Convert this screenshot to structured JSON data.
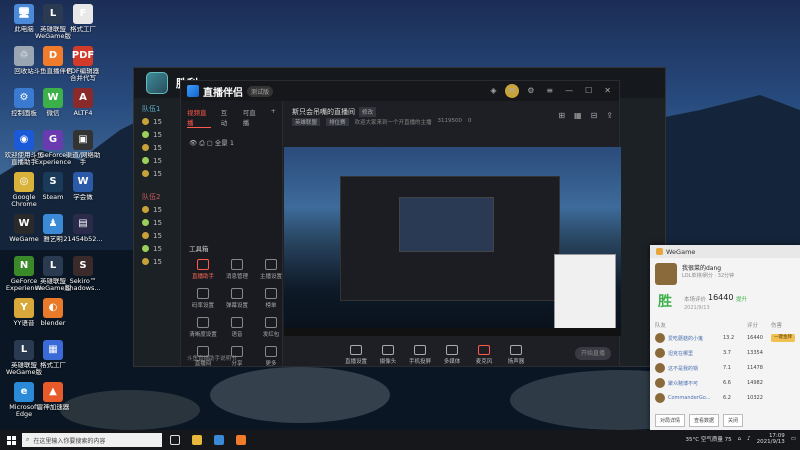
{
  "desktop": {
    "icons": [
      {
        "label": "此电脑",
        "color": "#4a8ad8",
        "glyph": "🖥"
      },
      {
        "label": "英雄联盟WeGame版",
        "color": "#2a3a50",
        "glyph": "L"
      },
      {
        "label": "格式工厂",
        "color": "#e8e8e8",
        "glyph": "F"
      },
      {
        "label": "回收站",
        "color": "#9aa6b2",
        "glyph": "♲"
      },
      {
        "label": "斗鱼直播伴侣",
        "color": "#f07b2a",
        "glyph": "D"
      },
      {
        "label": "PDF编辑器 合并代写",
        "color": "#d23a2a",
        "glyph": "PDF"
      },
      {
        "label": "控制面板",
        "color": "#3a7ad0",
        "glyph": "⚙"
      },
      {
        "label": "微信",
        "color": "#3cb14a",
        "glyph": "W"
      },
      {
        "label": "ALTF4",
        "color": "#8a2a2a",
        "glyph": "A"
      },
      {
        "label": "欢迎使用斗鱼直播助手",
        "color": "#1a5ad8",
        "glyph": "◉"
      },
      {
        "label": "GeForce Experience",
        "color": "#6a3ab0",
        "glyph": "G"
      },
      {
        "label": "渠道/网络助手",
        "color": "#333",
        "glyph": "▣"
      },
      {
        "label": "Google Chrome",
        "color": "#d8b23a",
        "glyph": "◎"
      },
      {
        "label": "Steam",
        "color": "#1a3a5a",
        "glyph": "S"
      },
      {
        "label": "学会做",
        "color": "#2a5aa8",
        "glyph": "W"
      },
      {
        "label": "WeGame",
        "color": "#2a2a2a",
        "glyph": "W"
      },
      {
        "label": "雅艺明",
        "color": "#3a8ad8",
        "glyph": "♟"
      },
      {
        "label": "21454b52...",
        "color": "#2a2a4a",
        "glyph": "▤"
      },
      {
        "label": "GeForce Experience",
        "color": "#3a8a2a",
        "glyph": "N"
      },
      {
        "label": "英雄联盟WeGame版",
        "color": "#2a3a50",
        "glyph": "L"
      },
      {
        "label": "Sekiro™ Shadows...",
        "color": "#3a2a2a",
        "glyph": "S"
      },
      {
        "label": "YY语音",
        "color": "#d8a83a",
        "glyph": "Y"
      },
      {
        "label": "blender",
        "color": "#e87a2a",
        "glyph": "◐"
      },
      {
        "label": "",
        "color": "transparent",
        "glyph": ""
      },
      {
        "label": "英雄联盟WeGame版",
        "color": "#2a3a50",
        "glyph": "L"
      },
      {
        "label": "格式工厂",
        "color": "#3a6ad8",
        "glyph": "▦"
      },
      {
        "label": "",
        "color": "transparent",
        "glyph": ""
      },
      {
        "label": "Microsoft Edge",
        "color": "#2a8ad8",
        "glyph": "e"
      },
      {
        "label": "雷神加速器",
        "color": "#e85a2a",
        "glyph": "▲"
      }
    ]
  },
  "wegame_main": {
    "title": "胜利",
    "sides": [
      "队伍1",
      "队伍2"
    ],
    "levels": [
      "15",
      "15",
      "15",
      "15",
      "15",
      "15",
      "15",
      "15",
      "15",
      "15"
    ]
  },
  "live": {
    "title": "直播伴侣",
    "badge": "测试版",
    "tabs": [
      "视频直播",
      "互动",
      "可直播"
    ],
    "scene": "全景 1",
    "tools_title": "工具箱",
    "tools": [
      "直播助手",
      "消息管理",
      "主播设置",
      "码率设置",
      "弹幕设置",
      "榜单",
      "清晰度设置",
      "语音",
      "发红包",
      "直播间",
      "分享",
      "更多"
    ],
    "footer": "斗鱼直播助手说明书",
    "room_title": "斯只会吊嘴的直播间",
    "room_tag": "修改",
    "room_sub": [
      "英雄联盟",
      "排位赛",
      "欢迎大家来到一个开直播的主播",
      "3119500",
      "0"
    ],
    "ctrl": [
      "直播设置",
      "摄像头",
      "手机投屏",
      "多媒体",
      "麦克风",
      "扬声器"
    ],
    "start": "开始直播"
  },
  "wg_popup": {
    "app": "WeGame",
    "user": "我很菜的dang",
    "sub": "LOL单排/刷分 · 32分钟",
    "result": "胜",
    "score_label": "本场评价",
    "score": "16440",
    "plus": "提升",
    "time": "2021/9/13",
    "headers": [
      "队友",
      "评分",
      "伤害"
    ],
    "rows": [
      {
        "name": "爱吃蘑菇的小鬼",
        "c1": "13.2",
        "c2": "16440",
        "mvp": "一键金牌"
      },
      {
        "name": "坦克在哪里",
        "c1": "3.7",
        "c2": "13354",
        "mvp": ""
      },
      {
        "name": "这不是我的锅",
        "c1": "7.1",
        "c2": "11478",
        "mvp": ""
      },
      {
        "name": "聚众赌博不可",
        "c1": "6.6",
        "c2": "14982",
        "mvp": ""
      },
      {
        "name": "CommanderGo...",
        "c1": "6.2",
        "c2": "10322",
        "mvp": ""
      }
    ],
    "foot": [
      "对局详情",
      "查看数据",
      "关闭"
    ]
  },
  "taskbar": {
    "search": "在这里输入你要搜索的内容",
    "weather": "35°C 空气质量 75",
    "time": "17:09",
    "date": "2021/9/13"
  }
}
